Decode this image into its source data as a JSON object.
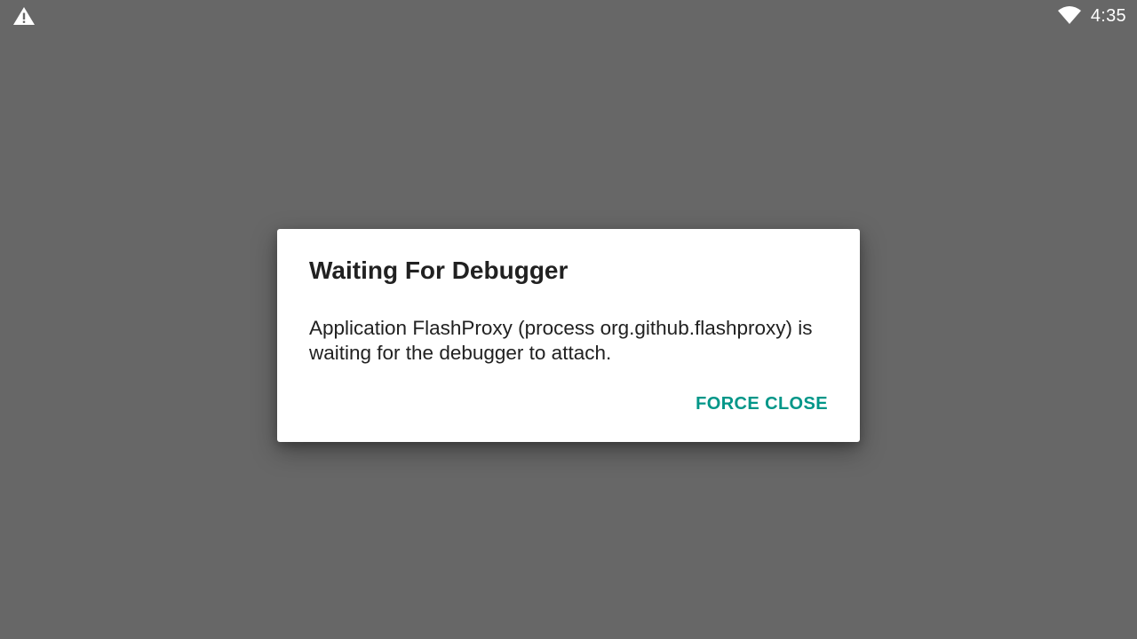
{
  "status_bar": {
    "time": "4:35",
    "left_icon": "warning-icon",
    "right_icon": "wifi-icon"
  },
  "dialog": {
    "title": "Waiting For Debugger",
    "message": "Application FlashProxy (process org.github.flashproxy) is waiting for the debugger to attach.",
    "button_label": "FORCE CLOSE"
  },
  "colors": {
    "background": "#676767",
    "dialog_background": "#ffffff",
    "title_text": "#212121",
    "accent": "#009688",
    "status_icons": "#ffffff"
  }
}
